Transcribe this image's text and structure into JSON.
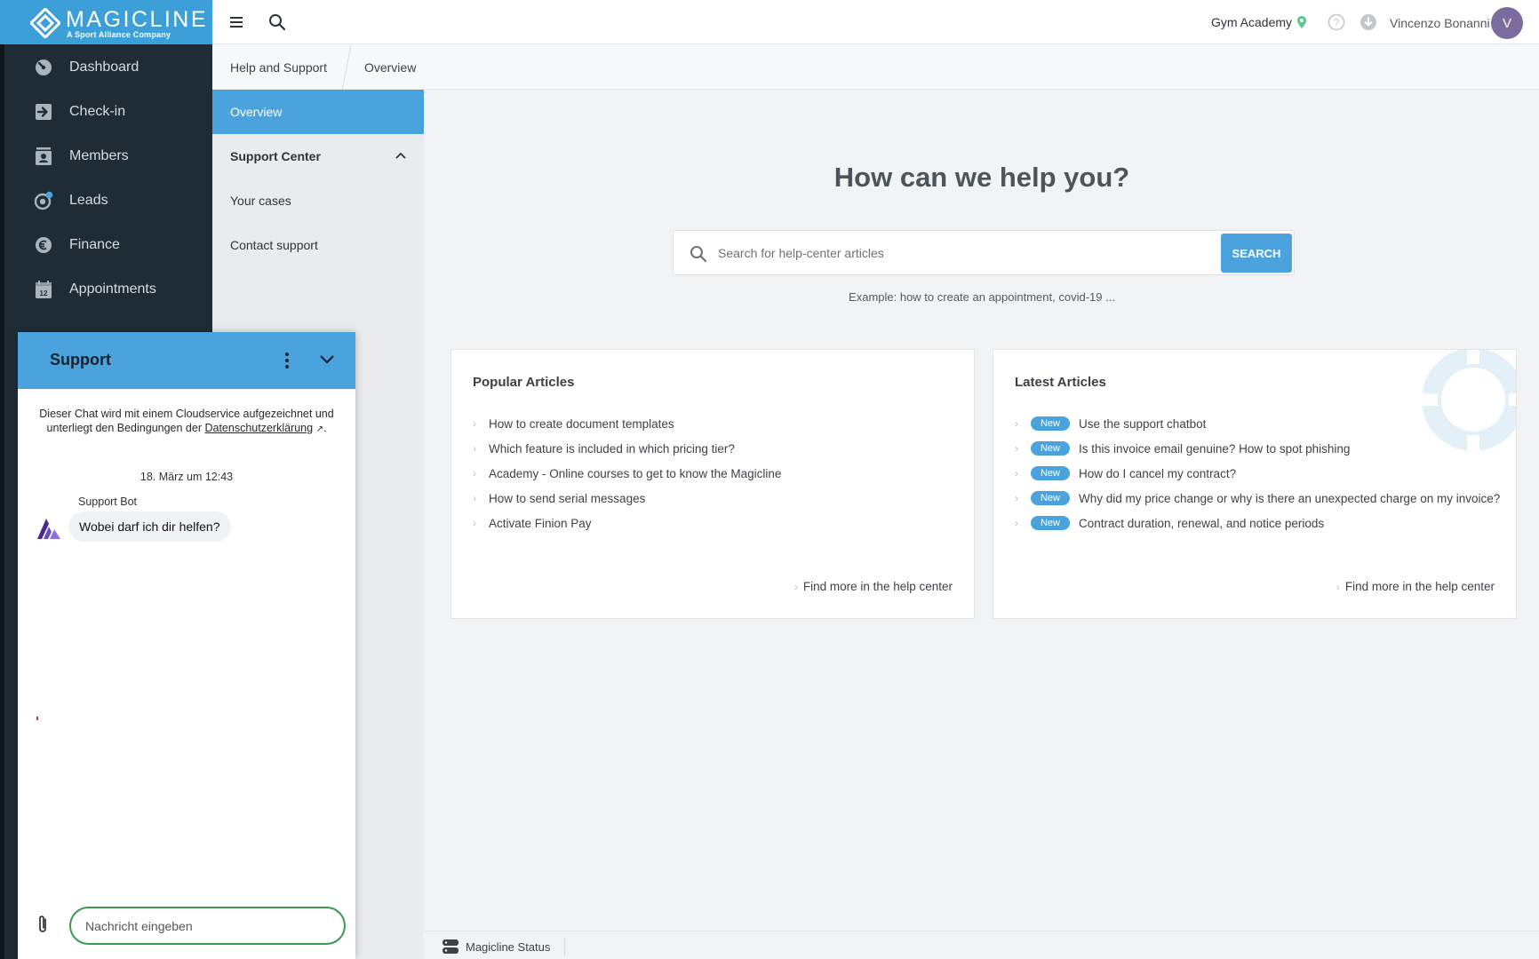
{
  "brand": {
    "name": "MAGICLINE",
    "tagline": "A Sport Alliance Company"
  },
  "sidebar": {
    "items": [
      {
        "label": "Dashboard",
        "icon": "dashboard-icon"
      },
      {
        "label": "Check-in",
        "icon": "check-in-icon"
      },
      {
        "label": "Members",
        "icon": "members-icon"
      },
      {
        "label": "Leads",
        "icon": "leads-icon"
      },
      {
        "label": "Finance",
        "icon": "finance-icon"
      },
      {
        "label": "Appointments",
        "icon": "calendar-icon"
      }
    ]
  },
  "header": {
    "studio": "Gym Academy",
    "user_name": "Vincenzo Bonanni",
    "avatar_initial": "V"
  },
  "breadcrumb": {
    "section": "Help and Support",
    "page": "Overview"
  },
  "submenu": {
    "items": [
      {
        "label": "Overview"
      },
      {
        "label": "Support Center"
      },
      {
        "label": "Your cases"
      },
      {
        "label": "Contact support"
      }
    ]
  },
  "help": {
    "title": "How can we help you?",
    "search_placeholder": "Search for help-center articles",
    "search_button": "SEARCH",
    "example": "Example: how to create an appointment, covid-19 ..."
  },
  "popular": {
    "title": "Popular Articles",
    "articles": [
      "How to create document templates",
      "Which feature is included in which pricing tier?",
      "Academy - Online courses to get to know the Magicline",
      "How to send serial messages",
      "Activate Finion Pay"
    ],
    "more": "Find more in the help center"
  },
  "latest": {
    "title": "Latest Articles",
    "badge": "New",
    "articles": [
      "Use the support chatbot",
      "Is this invoice email genuine? How to spot phishing",
      "How do I cancel my contract?",
      "Why did my price change or why is there an unexpected charge on my invoice?",
      "Contract duration, renewal, and notice periods"
    ],
    "more": "Find more in the help center"
  },
  "footer": {
    "status": "Magicline Status"
  },
  "chat": {
    "title": "Support",
    "notice_text": "Dieser Chat wird mit einem Cloudservice aufgezeichnet und unterliegt den Bedingungen der ",
    "notice_link": "Datenschutzerklärung",
    "notice_tail": ".",
    "date": "18. März um 12:43",
    "bot_name": "Support Bot",
    "bot_message": "Wobei darf ich dir helfen?",
    "input_placeholder": "Nachricht eingeben"
  },
  "colors": {
    "sidebar_bg": "#1f2c36",
    "accent": "#4aa3dc",
    "chat_input_border": "#3a9a4e",
    "avatar_bg": "#7b6b9f"
  }
}
